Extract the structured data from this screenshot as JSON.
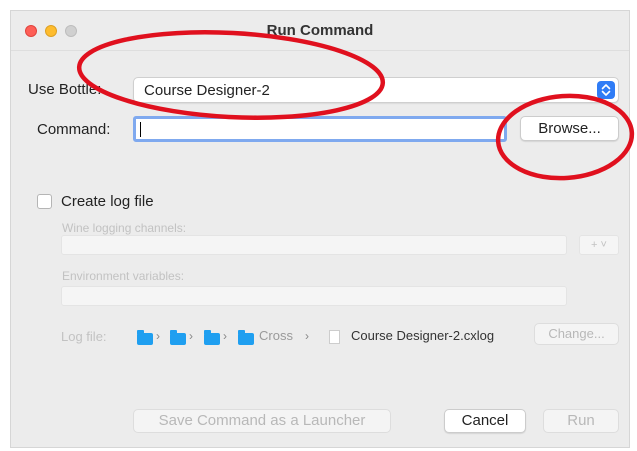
{
  "window": {
    "title": "Run Command"
  },
  "form": {
    "bottle_label": "Use Bottle:",
    "bottle_value": "Course Designer-2",
    "command_label": "Command:",
    "command_value": "",
    "browse_label": "Browse...",
    "log_checkbox_label": "Create log file",
    "log_checkbox_checked": false,
    "wine_channels_label": "Wine logging channels:",
    "add_channel_label": "+ ˅",
    "env_vars_label": "Environment variables:",
    "log_file_label": "Log file:",
    "log_path": [
      {
        "type": "folder",
        "label": ""
      },
      {
        "type": "folder",
        "label": ""
      },
      {
        "type": "folder",
        "label": ""
      },
      {
        "type": "folder",
        "label": "Cross"
      },
      {
        "type": "file",
        "label": "Course Designer-2.cxlog"
      }
    ],
    "path_separator": "›",
    "change_label": "Change..."
  },
  "footer": {
    "save_launcher_label": "Save Command as a Launcher",
    "cancel_label": "Cancel",
    "run_label": "Run"
  },
  "colors": {
    "accent": "#2f7cf6",
    "annotation": "#e0101e",
    "window_bg": "#ececec"
  }
}
